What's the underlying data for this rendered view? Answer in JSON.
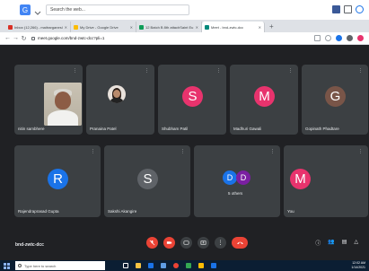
{
  "search_bar": {
    "placeholder": "Search the web..."
  },
  "tabs": [
    {
      "label": "Inbox (12,266) - maitrarganesl",
      "favicon_color": "#d93025"
    },
    {
      "label": "My Drive - Google Drive",
      "favicon_color": "#fbbc04"
    },
    {
      "label": "12 Batch B 8th attachSaint Eu",
      "favicon_color": "#0f9d58"
    },
    {
      "label": "Meet - bnd-zwtc-dcc",
      "favicon_color": "#00897b"
    }
  ],
  "address_bar": {
    "url": "meet.google.com/bnd-zwtc-dcc?pli=1"
  },
  "participants": [
    {
      "name": "nitin sambhere",
      "type": "camera"
    },
    {
      "name": "Pranaina Patel",
      "type": "photo"
    },
    {
      "name": "Shubham Patil",
      "initial": "S",
      "color": "#e8336d"
    },
    {
      "name": "Madhuri Gawali",
      "initial": "M",
      "color": "#e8336d"
    },
    {
      "name": "Gopinath Phadtare",
      "initial": "G",
      "color": "#795548"
    },
    {
      "name": "Rajendraprasad Gupta",
      "initial": "R",
      "color": "#1a73e8"
    },
    {
      "name": "Sakshi Akangire",
      "initial": "S",
      "color": "#5f6368"
    },
    {
      "name": "5 others",
      "initials": [
        "D",
        "D"
      ],
      "colors": [
        "#1a73e8",
        "#7b1fa2"
      ]
    },
    {
      "name": "You",
      "initial": "M",
      "color": "#e8336d"
    }
  ],
  "meeting": {
    "code": "bnd-zwtc-dcc"
  },
  "taskbar": {
    "search_placeholder": "Type here to search",
    "time": "12:02 AM",
    "date": "1/14/2021"
  }
}
